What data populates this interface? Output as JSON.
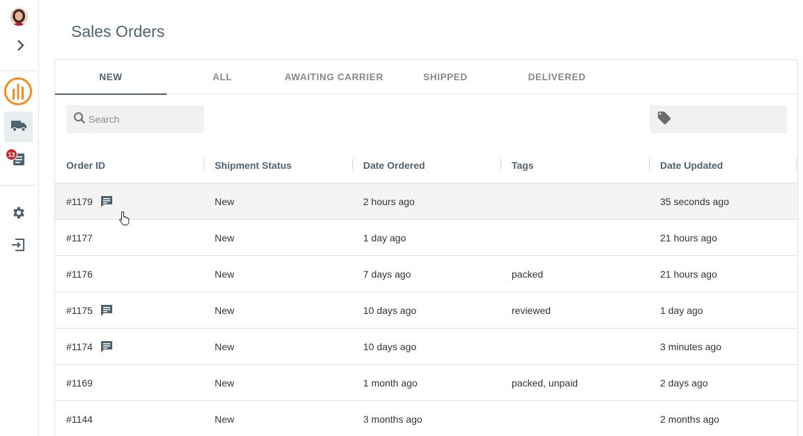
{
  "sidebar": {
    "avatar_icon": "user-avatar",
    "expand_icon": "chevron-right-icon",
    "logo_icon": "brand-logo-icon",
    "shipping_icon": "truck-icon",
    "orders_icon": "orders-list-icon",
    "orders_badge": "13",
    "settings_icon": "gear-icon",
    "logout_icon": "logout-icon",
    "accent_color": "#f28c1e"
  },
  "page": {
    "title": "Sales Orders"
  },
  "tabs": [
    {
      "label": "NEW",
      "active": true
    },
    {
      "label": "ALL",
      "active": false
    },
    {
      "label": "AWAITING CARRIER",
      "active": false
    },
    {
      "label": "SHIPPED",
      "active": false
    },
    {
      "label": "DELIVERED",
      "active": false
    }
  ],
  "search": {
    "placeholder": "Search",
    "value": "",
    "icon": "search-icon"
  },
  "tag_filter": {
    "icon": "tag-icon",
    "value": ""
  },
  "table": {
    "columns": [
      "Order ID",
      "Shipment Status",
      "Date Ordered",
      "Tags",
      "Date Updated"
    ],
    "rows": [
      {
        "id": "#1179",
        "status": "New",
        "ordered": "2 hours ago",
        "tags": "",
        "updated": "35 seconds ago",
        "has_comment": true
      },
      {
        "id": "#1177",
        "status": "New",
        "ordered": "1 day ago",
        "tags": "",
        "updated": "21 hours ago",
        "has_comment": false
      },
      {
        "id": "#1176",
        "status": "New",
        "ordered": "7 days ago",
        "tags": "packed",
        "updated": "21 hours ago",
        "has_comment": false
      },
      {
        "id": "#1175",
        "status": "New",
        "ordered": "10 days ago",
        "tags": "reviewed",
        "updated": "1 day ago",
        "has_comment": true
      },
      {
        "id": "#1174",
        "status": "New",
        "ordered": "10 days ago",
        "tags": "",
        "updated": "3 minutes ago",
        "has_comment": true
      },
      {
        "id": "#1169",
        "status": "New",
        "ordered": "1 month ago",
        "tags": "packed, unpaid",
        "updated": "2 days ago",
        "has_comment": false
      },
      {
        "id": "#1144",
        "status": "New",
        "ordered": "3 months ago",
        "tags": "",
        "updated": "2 months ago",
        "has_comment": false
      }
    ]
  }
}
